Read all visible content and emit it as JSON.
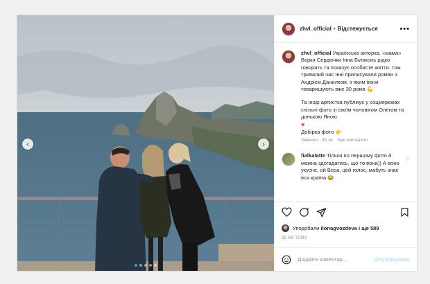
{
  "post": {
    "username": "zhvl_official",
    "separator": "•",
    "follow_label": "Відстежується",
    "more_label": "•••"
  },
  "caption": {
    "username": "zhvl_official",
    "p1": "Українська акторка, «мама» Вєрки Сердючки Інна Білоконь рідко говорить та показує особисте життя. тож тривалий час Інні приписували роман з Андрієм Данилком, з яким вони товаришують вже 30 років",
    "p1_emoji": "💪",
    "p2": "Та іноді артистка публікує у соцмережах спільні фото зі своїм чоловіком Олегом та донькою Яною",
    "p2_emoji": "♥",
    "p3": "Добірка фото",
    "p3_emoji": "👉",
    "meta_edited": "Змінено · 35 хв",
    "meta_translate": "See translation"
  },
  "comment": {
    "username": "fialkalatte",
    "text": "Тільки по першому фото й можна здогадатись, що то вона)) А воно укусне, ой Вєра, цей голос, мабуть знає вся країна",
    "emoji": "😂"
  },
  "likes": {
    "prefix": "Уподобали",
    "user": "ilonagvozdeva",
    "mid": "і ще",
    "count": "589"
  },
  "time_ago": "39 ХВ ТОМУ",
  "add_comment": {
    "placeholder": "Додайте коментар...",
    "publish_label": "Опублікувати"
  },
  "carousel": {
    "prev": "‹",
    "next": "›",
    "slides": 5,
    "active": 1
  },
  "icons": [
    "heart-icon",
    "comment-icon",
    "share-icon",
    "bookmark-icon",
    "emoji-icon"
  ],
  "colors": {
    "link": "#3897f0",
    "publish_disabled": "#b3dbff",
    "text": "#262626",
    "muted": "#8e8e8e"
  }
}
